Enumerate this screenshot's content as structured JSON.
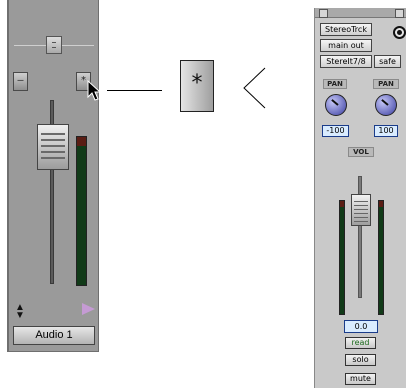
{
  "left_strip": {
    "pan_label": "",
    "minus_btn": "–",
    "star_btn": "*",
    "track_name": "Audio 1"
  },
  "callout": {
    "button_symbol": "*"
  },
  "right_strip": {
    "track_name": "StereoTrck",
    "output": "main out",
    "input": "StereIt7/8",
    "safe_label": "safe",
    "pan_left_label": "PAN",
    "pan_right_label": "PAN",
    "pan_left_value": "-100",
    "pan_right_value": "100",
    "vol_label": "VOL",
    "vol_value": "0.0",
    "read_label": "read",
    "solo_label": "solo",
    "mute_label": "mute"
  },
  "colors": {
    "left_strip_bg": "#9a9a9a",
    "right_strip_bg": "#c9c9c9",
    "meter_green": "#113a18",
    "meter_clip": "#5a1d14",
    "knob_blue": "#3a3ea0",
    "flag_purple": "#c59bd4"
  }
}
